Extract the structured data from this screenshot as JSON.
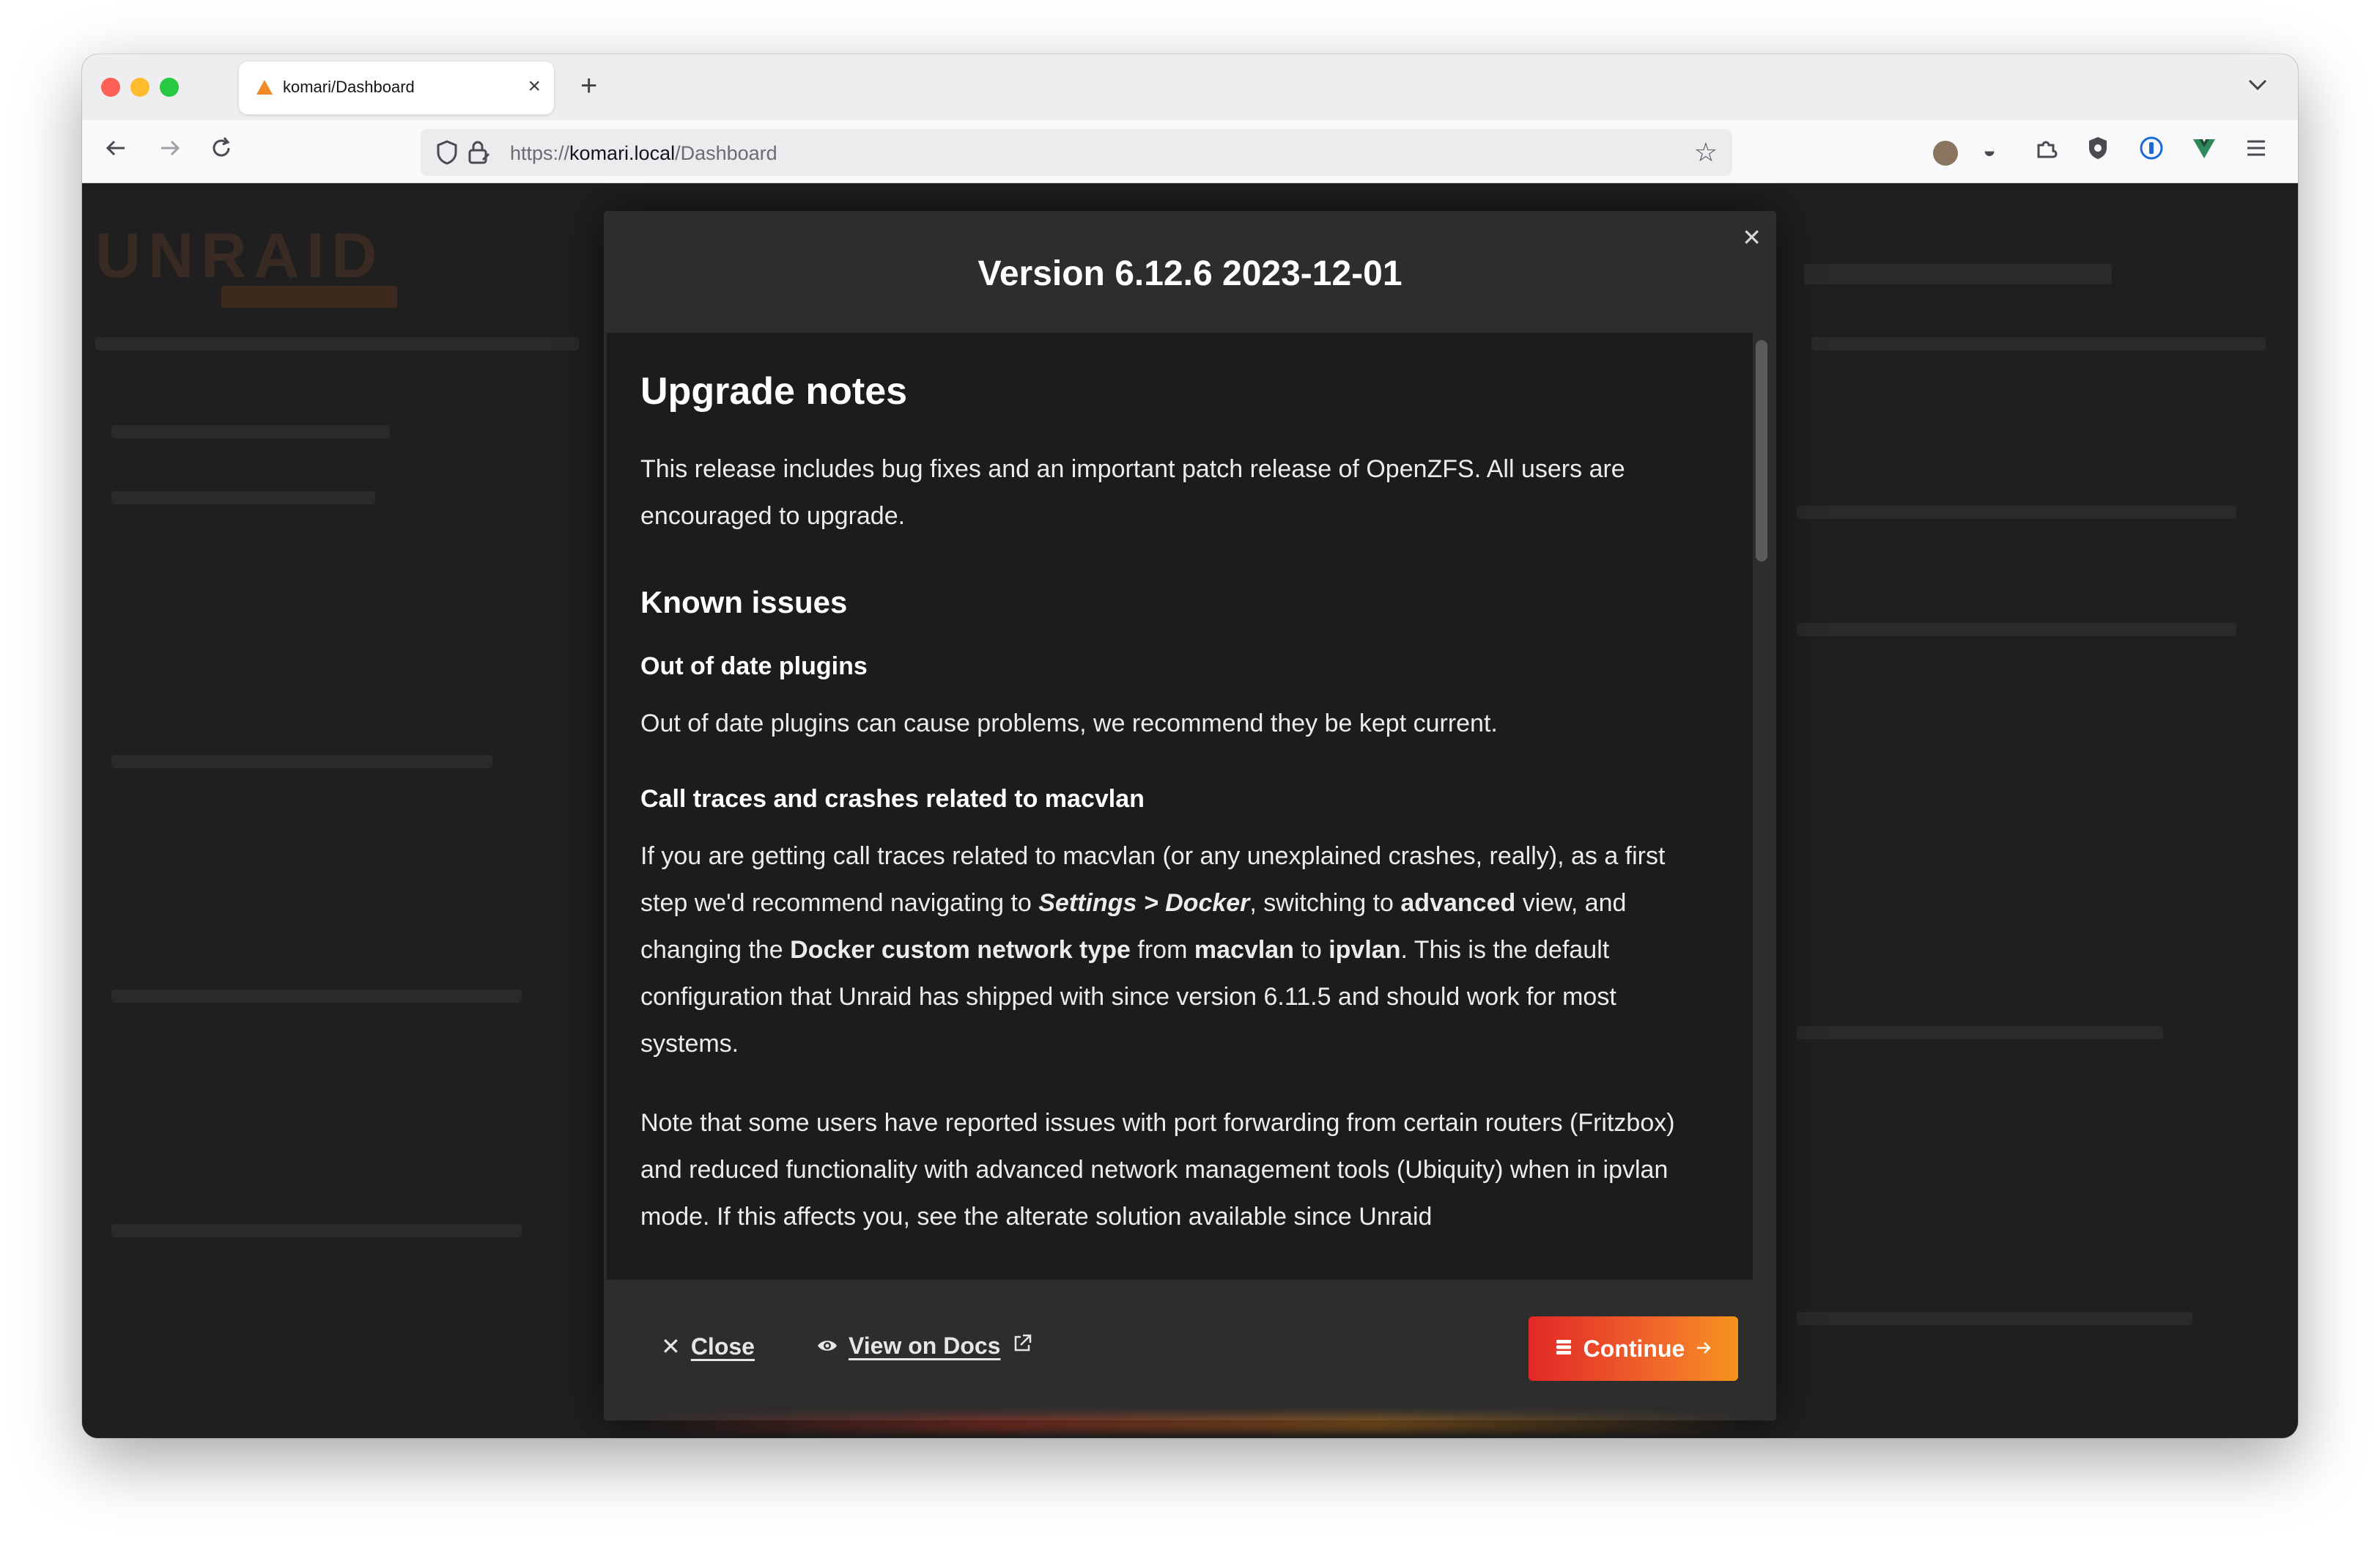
{
  "browser": {
    "tab_title": "komari/Dashboard",
    "url_scheme": "https://",
    "url_host": "komari.local",
    "url_path": "/Dashboard",
    "icons": [
      "back-icon",
      "forward-icon",
      "reload-icon",
      "shield-icon",
      "lock-icon",
      "star-icon",
      "extensions-icon",
      "menu-icon"
    ]
  },
  "modal": {
    "title": "Version 6.12.6 2023-12-01",
    "content": {
      "upgrade_heading": "Upgrade notes",
      "upgrade_text": "This release includes bug fixes and an important patch release of OpenZFS. All users are encouraged to upgrade.",
      "known_heading": "Known issues",
      "plugins_heading": "Out of date plugins",
      "plugins_text": "Out of date plugins can cause problems, we recommend they be kept current.",
      "macvlan_heading": "Call traces and crashes related to macvlan",
      "macvlan_p1": "If you are getting call traces related to macvlan (or any unexplained crashes, really), as a first step we'd recommend navigating to ",
      "macvlan_settings": "Settings > Docker",
      "macvlan_p2": ", switching to ",
      "macvlan_advanced": "advanced",
      "macvlan_p3": " view, and changing the ",
      "macvlan_network_type": "Docker custom network type",
      "macvlan_p4": " from ",
      "macvlan_macvlan": "macvlan",
      "macvlan_p5": " to ",
      "macvlan_ipvlan": "ipvlan",
      "macvlan_p6": ". This is the default configuration that Unraid has shipped with since version 6.11.5 and should work for most systems.",
      "note_text": "Note that some users have reported issues with port forwarding from certain routers (Fritzbox) and reduced functionality with advanced network management tools (Ubiquity) when in ipvlan mode. If this affects you, see the alterate solution available since Unraid"
    },
    "footer": {
      "close_label": "Close",
      "docs_label": "View on Docs",
      "continue_label": "Continue"
    }
  },
  "colors": {
    "accent_start": "#e22828",
    "accent_end": "#f7941d",
    "modal_bg": "#2d2d2d",
    "modal_body_bg": "#1c1c1c"
  }
}
